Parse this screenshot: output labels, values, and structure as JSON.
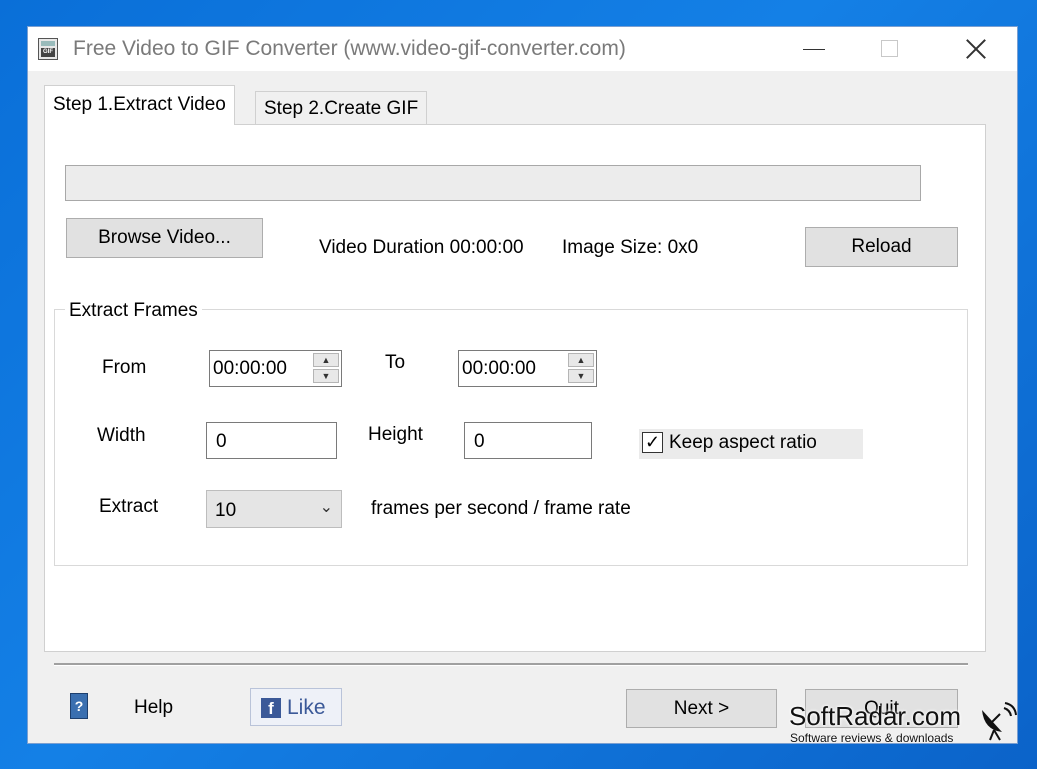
{
  "window": {
    "title": "Free Video to GIF Converter (www.video-gif-converter.com)",
    "icon": "gif-app-icon"
  },
  "tabs": [
    {
      "label": "Step 1.Extract Video",
      "active": true
    },
    {
      "label": "Step 2.Create GIF",
      "active": false
    }
  ],
  "extract": {
    "browse_label": "Browse Video...",
    "duration_text": "Video Duration 00:00:00",
    "image_size_text": "Image Size: 0x0",
    "reload_label": "Reload"
  },
  "frames": {
    "group_label": "Extract Frames",
    "from_label": "From",
    "from_value": "00:00:00",
    "to_label": "To",
    "to_value": "00:00:00",
    "width_label": "Width",
    "width_value": "0",
    "height_label": "Height",
    "height_value": "0",
    "keep_aspect_label": "Keep aspect ratio",
    "keep_aspect_checked": true,
    "extract_label": "Extract",
    "rate_value": "10",
    "rate_suffix": "frames per second / frame rate"
  },
  "footer": {
    "help_label": "Help",
    "like_label": "Like",
    "next_label": "Next >",
    "quit_label": "Quit"
  },
  "watermark": {
    "name": "SoftRadar.com",
    "tagline": "Software reviews & downloads"
  }
}
